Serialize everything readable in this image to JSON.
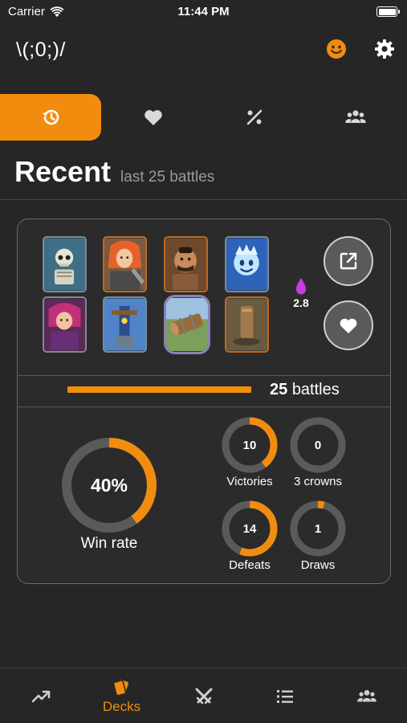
{
  "status_bar": {
    "carrier": "Carrier",
    "time": "11:44 PM"
  },
  "app": {
    "logo": "\\(;0;)/"
  },
  "colors": {
    "accent": "#f28c0f",
    "background": "#262626",
    "card_bg": "#2b2b2b",
    "ring_track": "#5a5a5a"
  },
  "top_tabs": [
    {
      "icon": "history-icon",
      "active": true
    },
    {
      "icon": "heart-icon",
      "active": false
    },
    {
      "icon": "percent-icon",
      "active": false
    },
    {
      "icon": "group-icon",
      "active": false
    }
  ],
  "heading": {
    "title": "Recent",
    "subtitle": "last 25 battles"
  },
  "deck": {
    "cards": [
      {
        "icon": "skeletons-card-icon"
      },
      {
        "icon": "valkyrie-card-icon"
      },
      {
        "icon": "hog-rider-card-icon"
      },
      {
        "icon": "ice-spirit-card-icon"
      },
      {
        "icon": "archer-card-icon"
      },
      {
        "icon": "x-bow-card-icon"
      },
      {
        "icon": "log-card-icon"
      },
      {
        "icon": "tombstone-card-icon"
      }
    ],
    "avg_elixir": "2.8",
    "battles_count": "25",
    "battles_label": "battles"
  },
  "stats": {
    "win_rate": {
      "value": "40%",
      "label": "Win rate",
      "fraction": 0.4
    },
    "victories": {
      "value": "10",
      "label": "Victories",
      "fraction": 0.4
    },
    "three_crowns": {
      "value": "0",
      "label": "3 crowns",
      "fraction": 0
    },
    "defeats": {
      "value": "14",
      "label": "Defeats",
      "fraction": 0.56
    },
    "draws": {
      "value": "1",
      "label": "Draws",
      "fraction": 0.04
    }
  },
  "bottom_nav": [
    {
      "icon": "trending-icon",
      "label": "",
      "active": false
    },
    {
      "icon": "decks-icon",
      "label": "Decks",
      "active": true
    },
    {
      "icon": "crossed-swords-icon",
      "label": "",
      "active": false
    },
    {
      "icon": "list-icon",
      "label": "",
      "active": false
    },
    {
      "icon": "group-icon",
      "label": "",
      "active": false
    }
  ]
}
